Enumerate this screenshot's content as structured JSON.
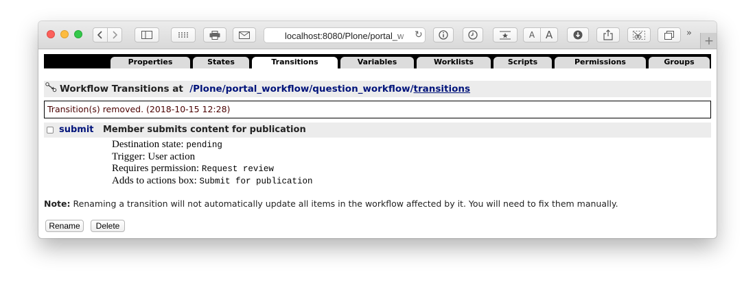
{
  "browser": {
    "url": "localhost:8080/Plone/portal_w",
    "more_glyph": "»",
    "newtab_glyph": "+",
    "font_small": "A",
    "font_large": "A",
    "reload_glyph": "↻"
  },
  "tabs": [
    {
      "label": "Properties",
      "active": false
    },
    {
      "label": "States",
      "active": false
    },
    {
      "label": "Transitions",
      "active": true
    },
    {
      "label": "Variables",
      "active": false
    },
    {
      "label": "Worklists",
      "active": false
    },
    {
      "label": "Scripts",
      "active": false
    },
    {
      "label": "Permissions",
      "active": false
    },
    {
      "label": "Groups",
      "active": false
    }
  ],
  "header": {
    "prefix": "Workflow Transitions at",
    "path": [
      {
        "label": "/Plone"
      },
      {
        "label": "/portal_workflow"
      },
      {
        "label": "/question_workflow"
      },
      {
        "label": "/"
      },
      {
        "label": "transitions"
      }
    ]
  },
  "status_message": "Transition(s) removed. (2018-10-15 12:28)",
  "transition": {
    "id": "submit",
    "checked": false,
    "description": "Member submits content for publication",
    "details": [
      {
        "label": "Destination state:",
        "value": "pending",
        "mono": true
      },
      {
        "label": "Trigger: User action",
        "value": "",
        "mono": false
      },
      {
        "label": "Requires permission:",
        "value": "Request review",
        "mono": true
      },
      {
        "label": "Adds to actions box:",
        "value": "Submit for publication",
        "mono": true
      }
    ]
  },
  "note": {
    "label": "Note:",
    "text": "Renaming a transition will not automatically update all items in the workflow affected by it. You will need to fix them manually."
  },
  "buttons": {
    "rename": "Rename",
    "delete": "Delete"
  },
  "colors": {
    "link": "#00137a",
    "message": "#4a0000",
    "tab_bg": "#dcdcdc",
    "row_bg": "#ececec"
  }
}
